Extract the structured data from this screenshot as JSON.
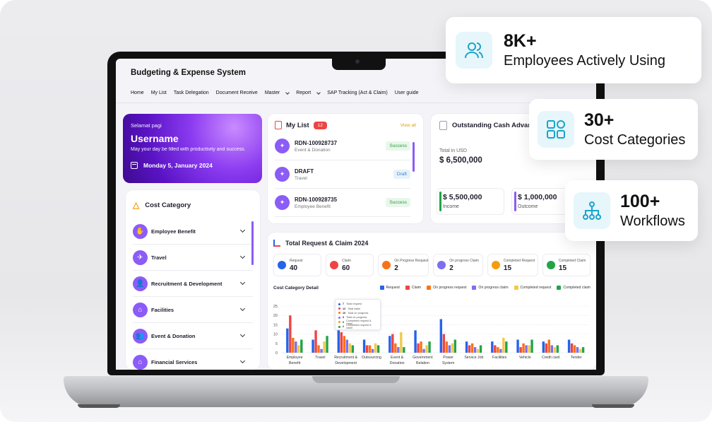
{
  "app": {
    "title": "Budgeting & Expense System",
    "nav": [
      {
        "label": "Home",
        "dropdown": false
      },
      {
        "label": "My List",
        "dropdown": false
      },
      {
        "label": "Task Delegation",
        "dropdown": false
      },
      {
        "label": "Document Receive",
        "dropdown": false
      },
      {
        "label": "Master",
        "dropdown": true
      },
      {
        "label": "Report",
        "dropdown": true
      },
      {
        "label": "SAP Tracking (Act & Claim)",
        "dropdown": false
      },
      {
        "label": "User guide",
        "dropdown": false
      }
    ]
  },
  "welcome": {
    "greeting": "Selamat pagi",
    "username": "Username",
    "message": "May your day be filled with productivity and success.",
    "date": "Monday 5, January 2024"
  },
  "cost_category": {
    "title": "Cost Category",
    "items": [
      {
        "label": "Employee Benefit",
        "icon": "hand-money-icon"
      },
      {
        "label": "Travel",
        "icon": "plane-icon"
      },
      {
        "label": "Recruitment & Development",
        "icon": "person-icon"
      },
      {
        "label": "Facilities",
        "icon": "chair-icon"
      },
      {
        "label": "Event & Donation",
        "icon": "people-icon"
      },
      {
        "label": "Financial Services",
        "icon": "bank-icon"
      }
    ]
  },
  "my_list": {
    "title": "My List",
    "count": "12",
    "view_all": "View all",
    "items": [
      {
        "id": "RDN-100928737",
        "category": "Event & Donation",
        "status": "Success",
        "status_type": "success"
      },
      {
        "id": "DRAFT",
        "category": "Travel",
        "status": "Draft",
        "status_type": "draft"
      },
      {
        "id": "RDN-100928735",
        "category": "Employee Benefit",
        "status": "Success",
        "status_type": "success"
      }
    ]
  },
  "outstanding": {
    "title": "Outstanding Cash Advan",
    "total_label": "Total in USD",
    "total_value": "$ 6,500,000",
    "income_value": "$ 5,500,000",
    "income_label": "Income",
    "outcome_value": "$ 1,000,000",
    "outcome_label": "Outcome",
    "colors": {
      "income": "#22a447",
      "outcome": "#8b5cf6"
    }
  },
  "total_request": {
    "title": "Total Request & Claim 2024",
    "stats": [
      {
        "label": "Request",
        "value": "40",
        "color": "#2563eb"
      },
      {
        "label": "Claim",
        "value": "60",
        "color": "#ef4444"
      },
      {
        "label": "On Progress Request",
        "value": "2",
        "color": "#f97316"
      },
      {
        "label": "On progress Claim",
        "value": "2",
        "color": "#7c6ff0"
      },
      {
        "label": "Completed Request",
        "value": "15",
        "color": "#f59e0b"
      },
      {
        "label": "Completed Claim",
        "value": "15",
        "color": "#22a447"
      }
    ],
    "detail_title": "Cost Category Detail",
    "tooltip": [
      {
        "value": "7",
        "label": "Total request",
        "color": "#2563eb"
      },
      {
        "value": "12",
        "label": "Total claim",
        "color": "#ef4444"
      },
      {
        "value": "10",
        "label": "Total on progress",
        "color": "#f97316"
      },
      {
        "value": "6",
        "label": "Total on progress",
        "color": "#7c6ff0"
      },
      {
        "value": "3",
        "label": "Completed request & claim",
        "color": "#f59e0b"
      },
      {
        "value": "2",
        "label": "Completed request & claim",
        "color": "#22a447"
      }
    ]
  },
  "chart_data": {
    "type": "bar",
    "title": "Cost Category Detail",
    "xlabel": "",
    "ylabel": "",
    "ylim": [
      0,
      25
    ],
    "yticks": [
      0,
      5,
      10,
      15,
      20,
      25
    ],
    "grid": true,
    "legend": "top-right",
    "categories": [
      "Employee Benefit",
      "Travel",
      "Recruitment & Development",
      "Outsourcing",
      "Event & Donation",
      "Government Relation",
      "Power System",
      "Service Job",
      "Facilities",
      "Vehicle",
      "Credit card",
      "Tender"
    ],
    "category_lines": [
      [
        "Employee",
        "Benefit"
      ],
      [
        "Travel"
      ],
      [
        "Recruitment &",
        "Development"
      ],
      [
        "Outsourcing"
      ],
      [
        "Event &",
        "Donation"
      ],
      [
        "Government",
        "Relation"
      ],
      [
        "Power",
        "System"
      ],
      [
        "Service Job"
      ],
      [
        "Facilities"
      ],
      [
        "Vehicle"
      ],
      [
        "Credit card"
      ],
      [
        "Tender"
      ]
    ],
    "series": [
      {
        "name": "Request",
        "color": "#2563eb",
        "values": [
          13,
          7,
          12,
          7,
          9,
          12,
          18,
          6,
          6,
          7,
          6,
          7
        ]
      },
      {
        "name": "Claim",
        "color": "#ef4444",
        "values": [
          20,
          12,
          11,
          4,
          10,
          5,
          10,
          4,
          4,
          3,
          5,
          5
        ]
      },
      {
        "name": "On progress request",
        "color": "#f97316",
        "values": [
          8,
          4,
          9,
          4,
          5,
          6,
          6,
          5,
          3,
          5,
          7,
          4
        ]
      },
      {
        "name": "On progress claim",
        "color": "#7c6ff0",
        "values": [
          6,
          2,
          7,
          2,
          3,
          2,
          4,
          3,
          2,
          4,
          4,
          3
        ]
      },
      {
        "name": "Completed request",
        "color": "#f2c94c",
        "values": [
          4,
          6,
          5,
          5,
          11,
          4,
          5,
          2,
          8,
          4,
          3,
          2
        ]
      },
      {
        "name": "Completed claim",
        "color": "#22a447",
        "values": [
          7,
          9,
          4,
          4,
          3,
          6,
          7,
          4,
          6,
          7,
          4,
          3
        ]
      }
    ]
  },
  "highlights": [
    {
      "value": "8K+",
      "label": "Employees Actively Using",
      "icon": "users-icon"
    },
    {
      "value": "30+",
      "label": "Cost Categories",
      "icon": "categories-icon"
    },
    {
      "value": "100+",
      "label": "Workflows",
      "icon": "workflow-icon"
    }
  ]
}
